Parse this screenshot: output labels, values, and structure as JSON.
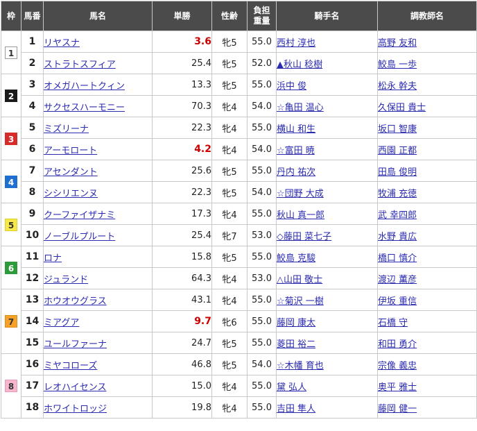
{
  "header": {
    "waku": "枠",
    "umaban": "馬番",
    "name": "馬名",
    "odds": "単勝",
    "sex_age": "性齢",
    "weight_line1": "負担",
    "weight_line2": "重量",
    "jockey": "騎手名",
    "trainer": "調教師名"
  },
  "waku_groups": [
    {
      "num": "1",
      "rows": 2,
      "bg": "#ffffff",
      "fg": "#333333",
      "border": "#999999"
    },
    {
      "num": "2",
      "rows": 2,
      "bg": "#1a1a1a",
      "fg": "#ffffff",
      "border": "#1a1a1a"
    },
    {
      "num": "3",
      "rows": 2,
      "bg": "#d62b2b",
      "fg": "#ffffff",
      "border": "#d62b2b"
    },
    {
      "num": "4",
      "rows": 2,
      "bg": "#1e6fd0",
      "fg": "#ffffff",
      "border": "#1e6fd0"
    },
    {
      "num": "5",
      "rows": 2,
      "bg": "#f6e84a",
      "fg": "#333333",
      "border": "#e0cf2a"
    },
    {
      "num": "6",
      "rows": 2,
      "bg": "#2e9a3a",
      "fg": "#ffffff",
      "border": "#2e9a3a"
    },
    {
      "num": "7",
      "rows": 3,
      "bg": "#f5a12a",
      "fg": "#333333",
      "border": "#e08d16"
    },
    {
      "num": "8",
      "rows": 3,
      "bg": "#f7b6cf",
      "fg": "#333333",
      "border": "#e99bb8"
    }
  ],
  "rows": [
    {
      "umaban": "1",
      "name": "リヤスナ",
      "odds": "3.6",
      "fav": true,
      "sex_age": "牝5",
      "weight": "55.0",
      "jockey": "西村 淳也",
      "trainer": "高野 友和"
    },
    {
      "umaban": "2",
      "name": "ストラトスフィア",
      "odds": "25.4",
      "fav": false,
      "sex_age": "牝5",
      "weight": "52.0",
      "jockey": "▲秋山 稔樹",
      "trainer": "鮫島 一歩"
    },
    {
      "umaban": "3",
      "name": "オメガハートクィン",
      "odds": "13.3",
      "fav": false,
      "sex_age": "牝5",
      "weight": "55.0",
      "jockey": "浜中 俊",
      "trainer": "松永 幹夫"
    },
    {
      "umaban": "4",
      "name": "サクセスハーモニー",
      "odds": "70.3",
      "fav": false,
      "sex_age": "牝4",
      "weight": "54.0",
      "jockey": "☆亀田 温心",
      "trainer": "久保田 貴士"
    },
    {
      "umaban": "5",
      "name": "ミズリーナ",
      "odds": "22.3",
      "fav": false,
      "sex_age": "牝4",
      "weight": "55.0",
      "jockey": "横山 和生",
      "trainer": "坂口 智康"
    },
    {
      "umaban": "6",
      "name": "アーモロート",
      "odds": "4.2",
      "fav": true,
      "sex_age": "牝4",
      "weight": "54.0",
      "jockey": "☆富田 暁",
      "trainer": "西園 正都"
    },
    {
      "umaban": "7",
      "name": "アセンダント",
      "odds": "25.6",
      "fav": false,
      "sex_age": "牝5",
      "weight": "55.0",
      "jockey": "丹内 祐次",
      "trainer": "田島 俊明"
    },
    {
      "umaban": "8",
      "name": "シシリエンヌ",
      "odds": "22.3",
      "fav": false,
      "sex_age": "牝5",
      "weight": "54.0",
      "jockey": "☆団野 大成",
      "trainer": "牧浦 充徳"
    },
    {
      "umaban": "9",
      "name": "クーファイザナミ",
      "odds": "17.3",
      "fav": false,
      "sex_age": "牝4",
      "weight": "55.0",
      "jockey": "秋山 真一郎",
      "trainer": "武 幸四郎"
    },
    {
      "umaban": "10",
      "name": "ノーブルプルート",
      "odds": "25.4",
      "fav": false,
      "sex_age": "牝7",
      "weight": "53.0",
      "jockey": "◇藤田 菜七子",
      "trainer": "水野 貴広"
    },
    {
      "umaban": "11",
      "name": "ロナ",
      "odds": "15.8",
      "fav": false,
      "sex_age": "牝5",
      "weight": "55.0",
      "jockey": "鮫島 克駿",
      "trainer": "橋口 慎介"
    },
    {
      "umaban": "12",
      "name": "ジュランド",
      "odds": "64.3",
      "fav": false,
      "sex_age": "牝4",
      "weight": "53.0",
      "jockey": "△山田 敬士",
      "trainer": "渡辺 薫彦"
    },
    {
      "umaban": "13",
      "name": "ホウオウグラス",
      "odds": "43.1",
      "fav": false,
      "sex_age": "牝4",
      "weight": "55.0",
      "jockey": "☆菊沢 一樹",
      "trainer": "伊坂 重信"
    },
    {
      "umaban": "14",
      "name": "ミアグア",
      "odds": "9.7",
      "fav": true,
      "sex_age": "牝6",
      "weight": "55.0",
      "jockey": "藤岡 康太",
      "trainer": "石橋 守"
    },
    {
      "umaban": "15",
      "name": "ユールファーナ",
      "odds": "24.7",
      "fav": false,
      "sex_age": "牝5",
      "weight": "55.0",
      "jockey": "菱田 裕二",
      "trainer": "和田 勇介"
    },
    {
      "umaban": "16",
      "name": "ミヤコローズ",
      "odds": "46.8",
      "fav": false,
      "sex_age": "牝5",
      "weight": "54.0",
      "jockey": "☆木幡 育也",
      "trainer": "宗像 義忠"
    },
    {
      "umaban": "17",
      "name": "レオハイセンス",
      "odds": "15.0",
      "fav": false,
      "sex_age": "牝4",
      "weight": "55.0",
      "jockey": "黛 弘人",
      "trainer": "奥平 雅士"
    },
    {
      "umaban": "18",
      "name": "ホワイトロッジ",
      "odds": "19.8",
      "fav": false,
      "sex_age": "牝4",
      "weight": "55.0",
      "jockey": "吉田 隼人",
      "trainer": "藤岡 健一"
    }
  ]
}
